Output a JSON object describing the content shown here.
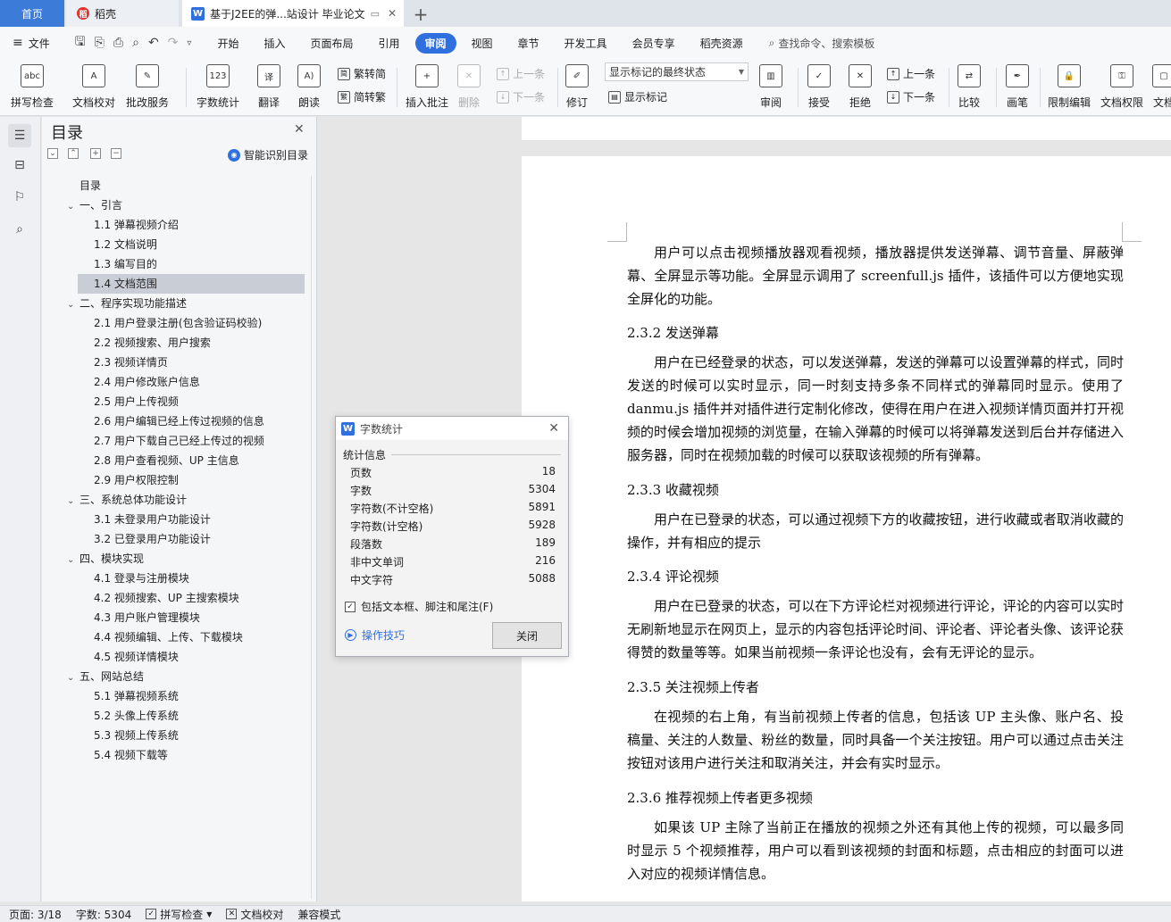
{
  "tabs": {
    "home": "首页",
    "daoke": "稻壳",
    "doc": "基于J2EE的弹...站设计 毕业论文"
  },
  "menu": {
    "file": "文件",
    "tabs": [
      "开始",
      "插入",
      "页面布局",
      "引用",
      "审阅",
      "视图",
      "章节",
      "开发工具",
      "会员专享",
      "稻壳资源"
    ],
    "active_tab": "审阅",
    "search": "查找命令、搜索模板"
  },
  "ribbon": {
    "spellcheck": "拼写检查",
    "doc_proof": "文档校对",
    "annotate_service": "批改服务",
    "word_count": "字数统计",
    "translate": "翻译",
    "read_aloud": "朗读",
    "trad_to_simp": "繁转简",
    "simp_to_trad": "简转繁",
    "insert_comment": "插入批注",
    "delete": "删除",
    "prev_comment": "上一条",
    "next_comment": "下一条",
    "track_changes": "修订",
    "markup_select": "显示标记的最终状态",
    "show_markup": "显示标记",
    "review": "审阅",
    "accept": "接受",
    "reject": "拒绝",
    "prev_change": "上一条",
    "next_change": "下一条",
    "compare": "比较",
    "pen": "画笔",
    "restrict_edit": "限制编辑",
    "doc_permission": "文档权限",
    "doc_cut": "文档"
  },
  "toc": {
    "title": "目录",
    "smart": "智能识别目录",
    "items": [
      {
        "label": "目录",
        "level": 0,
        "caret": ""
      },
      {
        "label": "一、引言",
        "level": 0,
        "caret": "v"
      },
      {
        "label": "1.1 弹幕视频介绍",
        "level": 1,
        "caret": ""
      },
      {
        "label": "1.2 文档说明",
        "level": 1,
        "caret": ""
      },
      {
        "label": "1.3 编写目的",
        "level": 1,
        "caret": ""
      },
      {
        "label": "1.4 文档范围",
        "level": 1,
        "caret": "",
        "selected": true
      },
      {
        "label": "二、程序实现功能描述",
        "level": 0,
        "caret": "v"
      },
      {
        "label": "2.1 用户登录注册(包含验证码校验)",
        "level": 1,
        "caret": ""
      },
      {
        "label": "2.2 视频搜索、用户搜索",
        "level": 1,
        "caret": ""
      },
      {
        "label": "2.3 视频详情页",
        "level": 1,
        "caret": ""
      },
      {
        "label": "2.4 用户修改账户信息",
        "level": 1,
        "caret": ""
      },
      {
        "label": "2.5 用户上传视频",
        "level": 1,
        "caret": ""
      },
      {
        "label": "2.6 用户编辑已经上传过视频的信息",
        "level": 1,
        "caret": ""
      },
      {
        "label": "2.7 用户下载自己已经上传过的视频",
        "level": 1,
        "caret": ""
      },
      {
        "label": "2.8 用户查看视频、UP 主信息",
        "level": 1,
        "caret": ""
      },
      {
        "label": "2.9 用户权限控制",
        "level": 1,
        "caret": ""
      },
      {
        "label": "三、系统总体功能设计",
        "level": 0,
        "caret": "v"
      },
      {
        "label": "3.1 未登录用户功能设计",
        "level": 1,
        "caret": ""
      },
      {
        "label": "3.2 已登录用户功能设计",
        "level": 1,
        "caret": ""
      },
      {
        "label": "四、模块实现",
        "level": 0,
        "caret": "v"
      },
      {
        "label": "4.1 登录与注册模块",
        "level": 1,
        "caret": ""
      },
      {
        "label": "4.2 视频搜索、UP 主搜索模块",
        "level": 1,
        "caret": ""
      },
      {
        "label": "4.3 用户账户管理模块",
        "level": 1,
        "caret": ""
      },
      {
        "label": "4.4 视频编辑、上传、下载模块",
        "level": 1,
        "caret": ""
      },
      {
        "label": "4.5 视频详情模块",
        "level": 1,
        "caret": ""
      },
      {
        "label": "五、网站总结",
        "level": 0,
        "caret": "v"
      },
      {
        "label": "5.1 弹幕视频系统",
        "level": 1,
        "caret": ""
      },
      {
        "label": "5.2 头像上传系统",
        "level": 1,
        "caret": ""
      },
      {
        "label": "5.3 视频上传系统",
        "level": 1,
        "caret": ""
      },
      {
        "label": "5.4 视频下载等",
        "level": 1,
        "caret": ""
      }
    ]
  },
  "document": {
    "p1": "用户可以点击视频播放器观看视频，播放器提供发送弹幕、调节音量、屏蔽弹幕、全屏显示等功能。全屏显示调用了 screenfull.js 插件，该插件可以方便地实现全屏化的功能。",
    "h232": "2.3.2 发送弹幕",
    "p2": "用户在已经登录的状态，可以发送弹幕，发送的弹幕可以设置弹幕的样式，同时发送的时候可以实时显示，同一时刻支持多条不同样式的弹幕同时显示。使用了 danmu.js 插件并对插件进行定制化修改，使得在用户在进入视频详情页面并打开视频的时候会增加视频的浏览量，在输入弹幕的时候可以将弹幕发送到后台并存储进入服务器，同时在视频加载的时候可以获取该视频的所有弹幕。",
    "h233": "2.3.3 收藏视频",
    "p3": "用户在已登录的状态，可以通过视频下方的收藏按钮，进行收藏或者取消收藏的操作，并有相应的提示",
    "h234": "2.3.4 评论视频",
    "p4": "用户在已登录的状态，可以在下方评论栏对视频进行评论，评论的内容可以实时无刷新地显示在网页上，显示的内容包括评论时间、评论者、评论者头像、该评论获得赞的数量等等。如果当前视频一条评论也没有，会有无评论的显示。",
    "h235": "2.3.5 关注视频上传者",
    "p5": "在视频的右上角，有当前视频上传者的信息，包括该 UP 主头像、账户名、投稿量、关注的人数量、粉丝的数量，同时具备一个关注按钮。用户可以通过点击关注按钮对该用户进行关注和取消关注，并会有实时显示。",
    "h236": "2.3.6 推荐视频上传者更多视频",
    "p6": "如果该 UP 主除了当前正在播放的视频之外还有其他上传的视频，可以最多同时显示 5 个视频推荐，用户可以看到该视频的封面和标题，点击相应的封面可以进入对应的视频详情信息。"
  },
  "dialog": {
    "title": "字数统计",
    "section": "统计信息",
    "stats": [
      {
        "label": "页数",
        "value": "18"
      },
      {
        "label": "字数",
        "value": "5304"
      },
      {
        "label": "字符数(不计空格)",
        "value": "5891"
      },
      {
        "label": "字符数(计空格)",
        "value": "5928"
      },
      {
        "label": "段落数",
        "value": "189"
      },
      {
        "label": "非中文单词",
        "value": "216"
      },
      {
        "label": "中文字符",
        "value": "5088"
      }
    ],
    "include_label": "包括文本框、脚注和尾注(F)",
    "include_checked": true,
    "tips": "操作技巧",
    "close": "关闭"
  },
  "status": {
    "page": "页面: 3/18",
    "words": "字数: 5304",
    "spell": "拼写检查",
    "proof": "文档校对",
    "compat": "兼容模式"
  }
}
